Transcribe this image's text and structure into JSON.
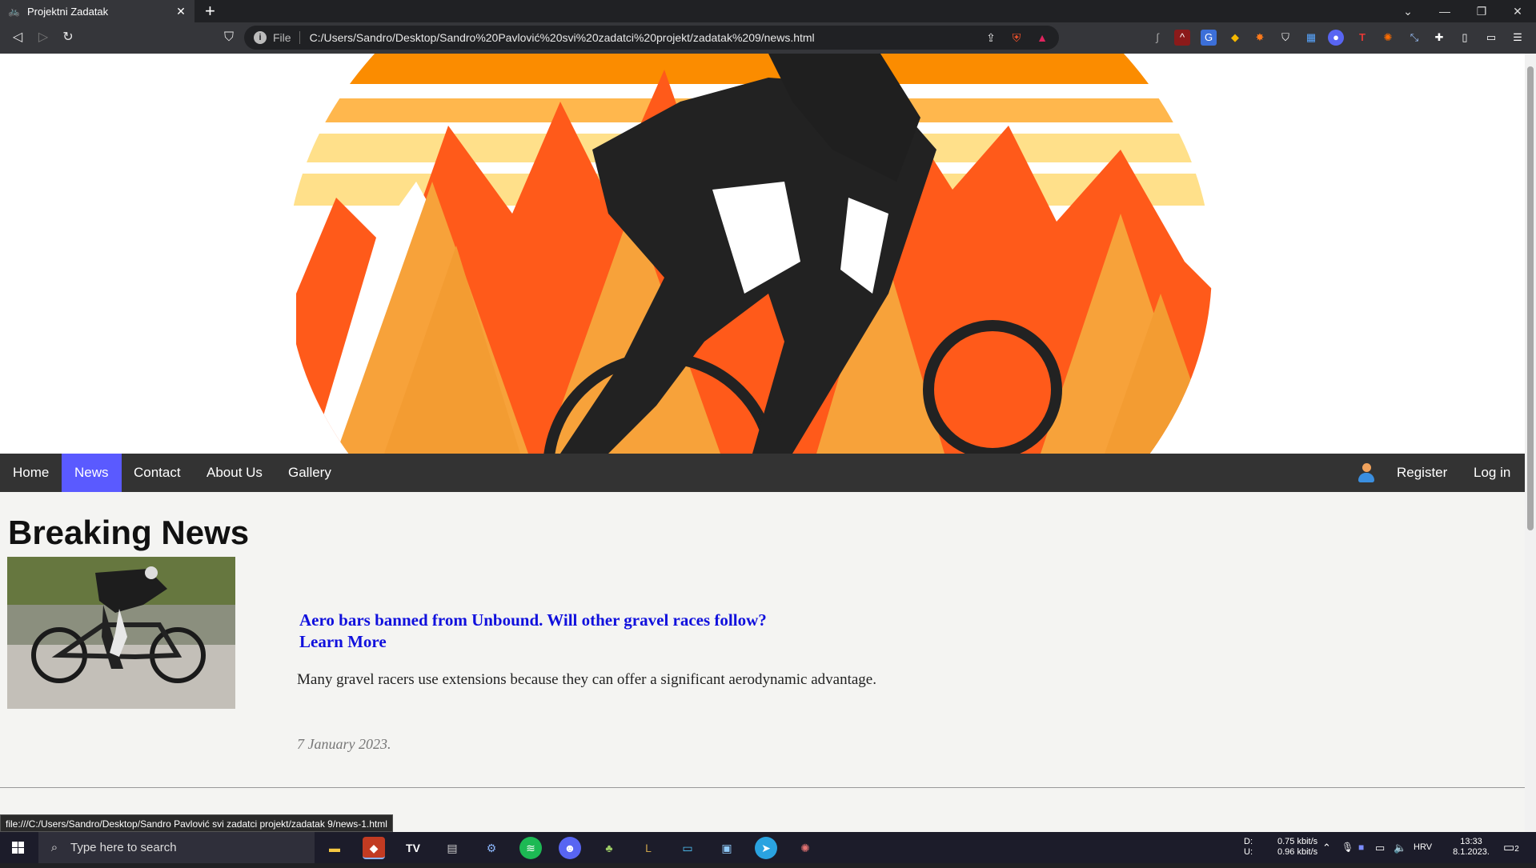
{
  "browser": {
    "tab_title": "Projektni Zadatak",
    "new_tab": "+",
    "url_scheme": "File",
    "url": "C:/Users/Sandro/Desktop/Sandro%20Pavlović%20svi%20zadatci%20projekt/zadatak%209/news.html",
    "status_url": "file:///C:/Users/Sandro/Desktop/Sandro Pavlović svi zadatci projekt/zadatak 9/news-1.html"
  },
  "nav": {
    "home": "Home",
    "news": "News",
    "contact": "Contact",
    "about": "About Us",
    "gallery": "Gallery",
    "register": "Register",
    "login": "Log in"
  },
  "page": {
    "title": "Breaking News"
  },
  "article": {
    "headline": "Aero bars banned from Unbound. Will other gravel races follow?",
    "learn_more": "Learn More",
    "summary": "Many gravel racers use extensions because they can offer a significant aerodynamic advantage.",
    "date": "7 January 2023."
  },
  "taskbar": {
    "search_placeholder": "Type here to search",
    "net_down_label": "D:",
    "net_up_label": "U:",
    "net_down": "0.75 kbit/s",
    "net_up": "0.96 kbit/s",
    "lang": "HRV",
    "time": "13:33",
    "date": "8.1.2023.",
    "notif_count": "2"
  },
  "colors": {
    "nav_active": "#5a5aff",
    "link": "#1010dd",
    "navbar_bg": "#333333"
  }
}
